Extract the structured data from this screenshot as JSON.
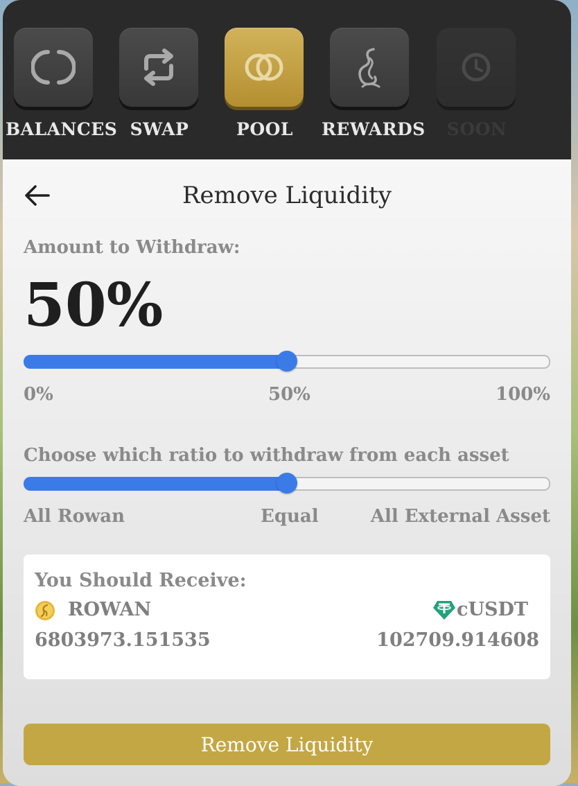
{
  "nav": {
    "items": [
      {
        "label": "BALANCES",
        "icon": "balances-icon",
        "state": "normal"
      },
      {
        "label": "SWAP",
        "icon": "swap-icon",
        "state": "normal"
      },
      {
        "label": "POOL",
        "icon": "pool-icon",
        "state": "active"
      },
      {
        "label": "REWARDS",
        "icon": "rewards-icon",
        "state": "normal"
      },
      {
        "label": "SOON",
        "icon": "clock-icon",
        "state": "disabled"
      }
    ]
  },
  "page": {
    "title": "Remove Liquidity"
  },
  "withdraw": {
    "label": "Amount to Withdraw:",
    "value_text": "50%",
    "slider_value": 50,
    "ticks": [
      "0%",
      "50%",
      "100%"
    ]
  },
  "ratio": {
    "label": "Choose which ratio to withdraw from each asset",
    "slider_value": 0.5,
    "ticks": [
      "All Rowan",
      "Equal",
      "All External Asset"
    ]
  },
  "receive": {
    "label": "You Should Receive:",
    "assets": [
      {
        "symbol": "ROWAN",
        "amount": "6803973.151535",
        "icon": "rowan-coin-icon"
      },
      {
        "symbol": "cUSDT",
        "amount": "102709.914608",
        "icon": "tether-icon"
      }
    ]
  },
  "actions": {
    "submit_label": "Remove Liquidity"
  },
  "colors": {
    "accent_gold": "#c4a745",
    "slider_blue": "#3a7be8",
    "nav_bg": "#2a2a2a"
  }
}
